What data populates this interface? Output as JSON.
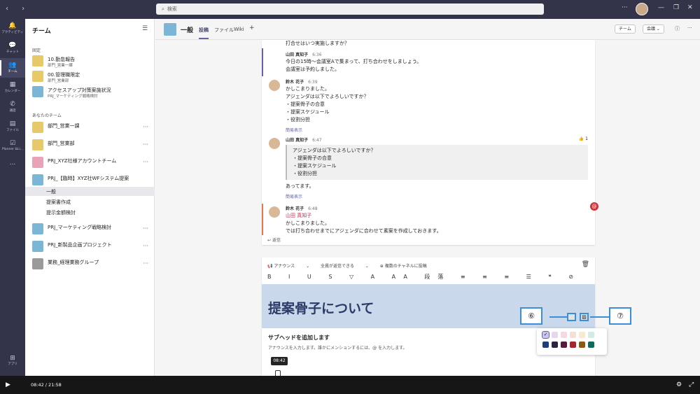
{
  "search": {
    "placeholder": "検索"
  },
  "rail": [
    {
      "label": "アクティビティ",
      "icon": "bell-icon"
    },
    {
      "label": "チャット",
      "icon": "chat-icon"
    },
    {
      "label": "チーム",
      "icon": "people-icon"
    },
    {
      "label": "カレンダー",
      "icon": "calendar-icon"
    },
    {
      "label": "通話",
      "icon": "phone-icon"
    },
    {
      "label": "ファイル",
      "icon": "file-icon"
    },
    {
      "label": "Planner &Li...",
      "icon": "planner-icon"
    },
    {
      "label": "...",
      "icon": "more-icon"
    }
  ],
  "rail_apps": "アプリ",
  "sidebar": {
    "title": "チーム",
    "pinned_label": "固定",
    "your_teams_label": "あなたのチーム",
    "pinned": [
      {
        "name": "10.勤怠報告",
        "sub": "部門_営業一課"
      },
      {
        "name": "00.管理職限定",
        "sub": "部門_営業部"
      },
      {
        "name": "アクセスアップ対策案施状況",
        "sub": "PRJ_マーケティング戦略検討"
      }
    ],
    "teams": [
      {
        "name": "部門_営業一課"
      },
      {
        "name": "部門_営業部"
      },
      {
        "name": "PRJ_XYZ社様アカウントチーム"
      },
      {
        "name": "PRJ_【臨時】XYZ社WFシステム提案"
      },
      {
        "name": "PRJ_マーケティング戦略検討"
      },
      {
        "name": "PRJ_新製品企画プロジェクト"
      },
      {
        "name": "業務_経理業務グループ"
      }
    ],
    "channels": [
      "一般",
      "提案書作成",
      "提示金額検討"
    ]
  },
  "header": {
    "team": "一般",
    "tabs": [
      "投稿",
      "ファイル",
      "Wiki"
    ],
    "team_btn": "チーム",
    "meet_btn": "会議"
  },
  "feed": {
    "top_line": "打合せはいつ実施しますか？",
    "m1": {
      "author": "山田 真知子",
      "time": "6:36",
      "lines": [
        "今日の15時～会議室Aで集まって、打ち合わせをしましょう。",
        "会議室は予約しました。"
      ]
    },
    "m2": {
      "author": "鈴木 花子",
      "time": "6:39",
      "lines": [
        "かしこまりました。",
        "アジェンダは以下でよろしいですか？",
        "・提案骨子の合意",
        "・提案スケジュール",
        "・役割分担"
      ],
      "more": "簡易表示"
    },
    "m3": {
      "author": "山田 真知子",
      "time": "6:47",
      "quote": [
        "アジェンダは以下でよろしいですか？",
        "・提案骨子の合意",
        "・提案スケジュール",
        "・役割分担"
      ],
      "after": "あってます。",
      "more": "簡易表示",
      "like": "1"
    },
    "m4": {
      "author": "鈴木 花子",
      "time": "6:48",
      "mention": "山田 真知子",
      "lines": [
        "かしこまりました。",
        "では打ち合わせまでにアジェンダに合わせて素案を作成しておきます。"
      ]
    },
    "reply": "返信"
  },
  "compose": {
    "announce": "アナウンス",
    "who": "全員が返信できる",
    "multi": "複数のチャネルに投稿",
    "heading": "提案骨子について",
    "subhead": "サブヘッドを追加します",
    "body": "アナウンスを入力します。誰かにメンションするには、@ を入力します。",
    "toolbar": "B I U S ▽ A AA 段落 ≡ ≡ ≡ ☰ ❝ ⊘ </> ▦ ! …"
  },
  "callouts": [
    "⑥",
    "⑦"
  ],
  "palette": {
    "row1": [
      "#c8c6f0",
      "#e7d6ec",
      "#f6d8e4",
      "#f4e0d4",
      "#f7ead0",
      "#d4ebe4"
    ],
    "row2": [
      "#1e3d7a",
      "#2b2640",
      "#5a1a3a",
      "#a4262c",
      "#8a5a12",
      "#0e6a5c"
    ]
  },
  "video": {
    "time": "08:42 / 21:58",
    "tooltip": "08:42",
    "progress": 0.4
  }
}
